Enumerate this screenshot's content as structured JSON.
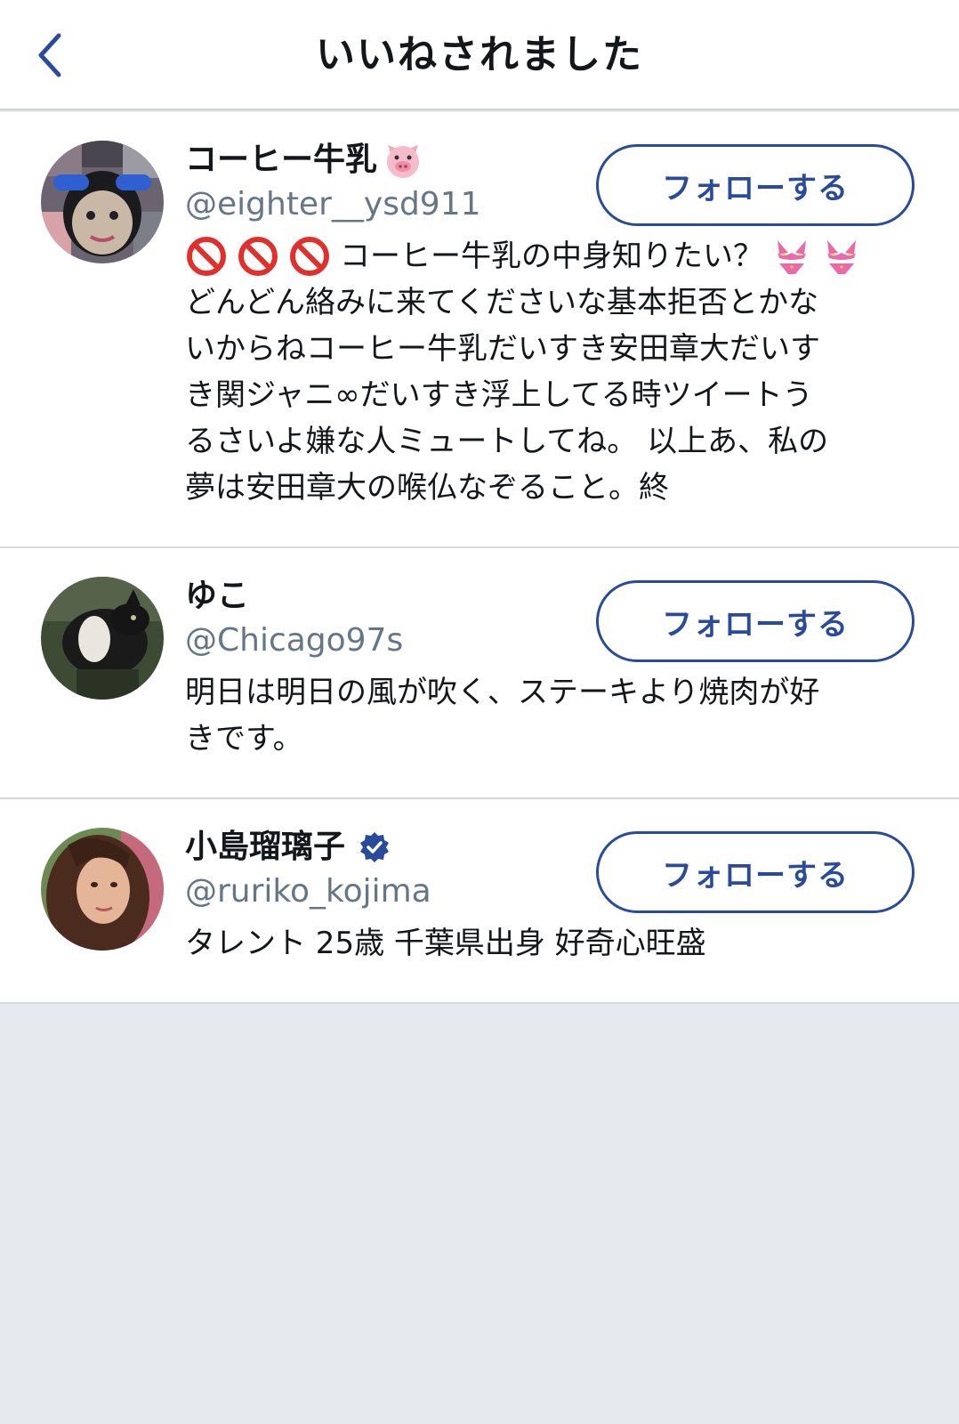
{
  "navbar": {
    "title": "いいねされました",
    "back_icon": "chevron-left-icon"
  },
  "colors": {
    "accent": "#2a4a9a",
    "text": "#14171a",
    "handle": "#657786",
    "background": "#e6e9ee",
    "verified": "#2a4a9a"
  },
  "users": [
    {
      "name": "コーヒー牛乳",
      "name_emoji": "pig-face-icon",
      "handle": "@eighter__ysd911",
      "follow_label": "フォローする",
      "bio_lines": [
        "コーヒー牛乳の中身知りたい？",
        "どんどん絡みに来てくださいな基本拒否とかな",
        "いからねコーヒー牛乳だいすき安田章大だいす",
        "き関ジャニ∞だいすき浮上してる時ツイートう",
        "るさいよ嫌な人ミュートしてね。 以上あ、私の",
        "夢は安田章大の喉仏なぞること。終"
      ],
      "bio_leading_icons": [
        "no-entry-icon",
        "no-entry-icon",
        "no-entry-icon"
      ],
      "bio_trailing_icons": [
        "bikini-icon",
        "bikini-icon"
      ]
    },
    {
      "name": "ゆこ",
      "handle": "@Chicago97s",
      "follow_label": "フォローする",
      "bio_lines": [
        "明日は明日の風が吹く、ステーキより焼肉が好",
        "きです。"
      ]
    },
    {
      "name": "小島瑠璃子",
      "verified": true,
      "handle": "@ruriko_kojima",
      "follow_label": "フォローする",
      "bio_lines": [
        "タレント 25歳 千葉県出身 好奇心旺盛"
      ]
    }
  ]
}
